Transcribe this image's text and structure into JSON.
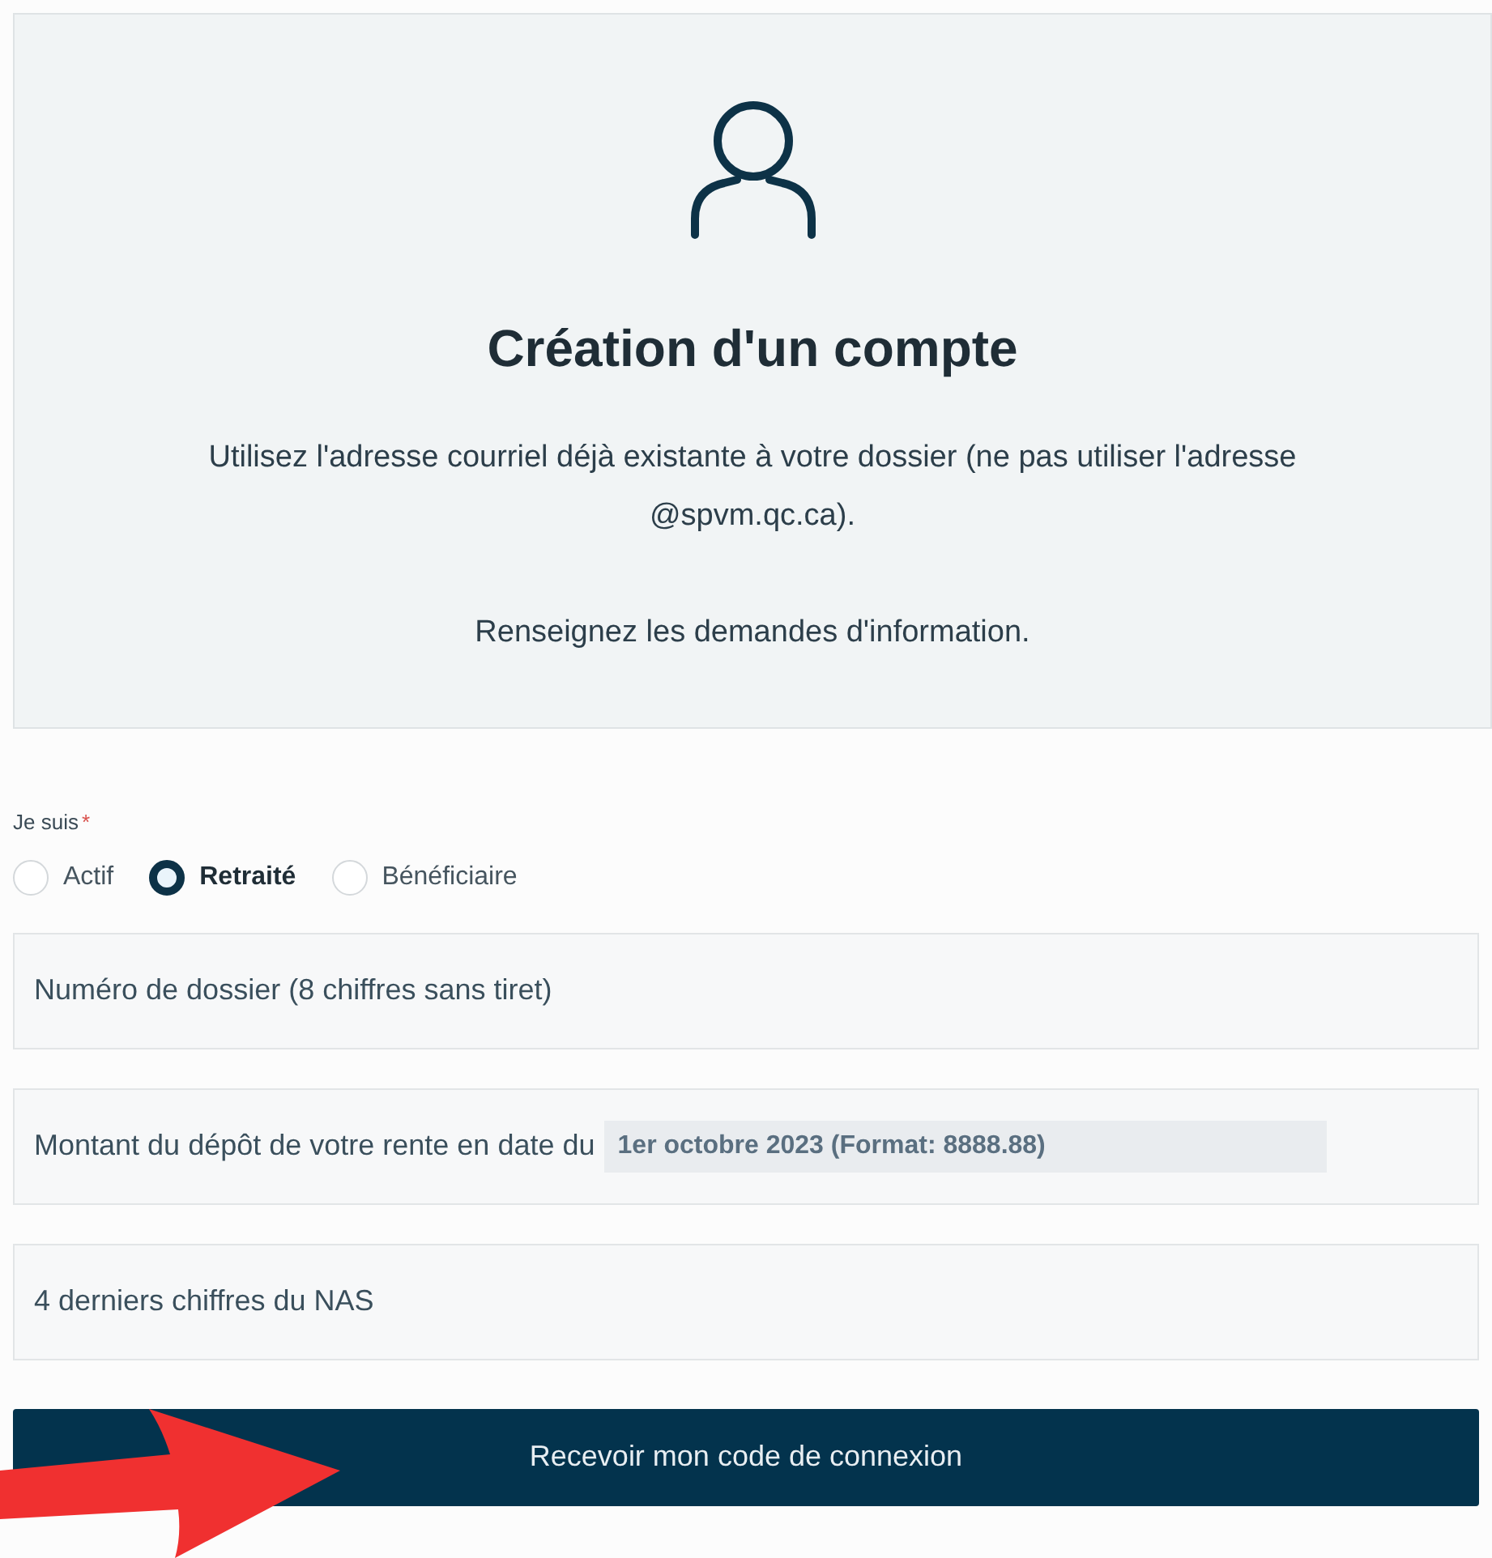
{
  "header": {
    "title": "Création d'un compte",
    "paragraphs": [
      "Utilisez l'adresse courriel déjà existante à votre dossier (ne pas utiliser l'adresse @spvm.qc.ca).",
      "Renseignez les demandes d'information."
    ]
  },
  "status": {
    "label": "Je suis",
    "required_mark": "*",
    "options": [
      {
        "label": "Actif",
        "selected": false
      },
      {
        "label": "Retraité",
        "selected": true
      },
      {
        "label": "Bénéficiaire",
        "selected": false
      }
    ]
  },
  "fields": [
    {
      "placeholder": "Numéro de dossier (8 chiffres sans tiret)"
    },
    {
      "placeholder": "Montant du dépôt de votre rente en date du",
      "note": "1er octobre 2023 (Format: 8888.88)"
    },
    {
      "placeholder": "4 derniers chiffres du NAS"
    }
  ],
  "submit": {
    "label": "Recevoir mon code de connexion"
  }
}
